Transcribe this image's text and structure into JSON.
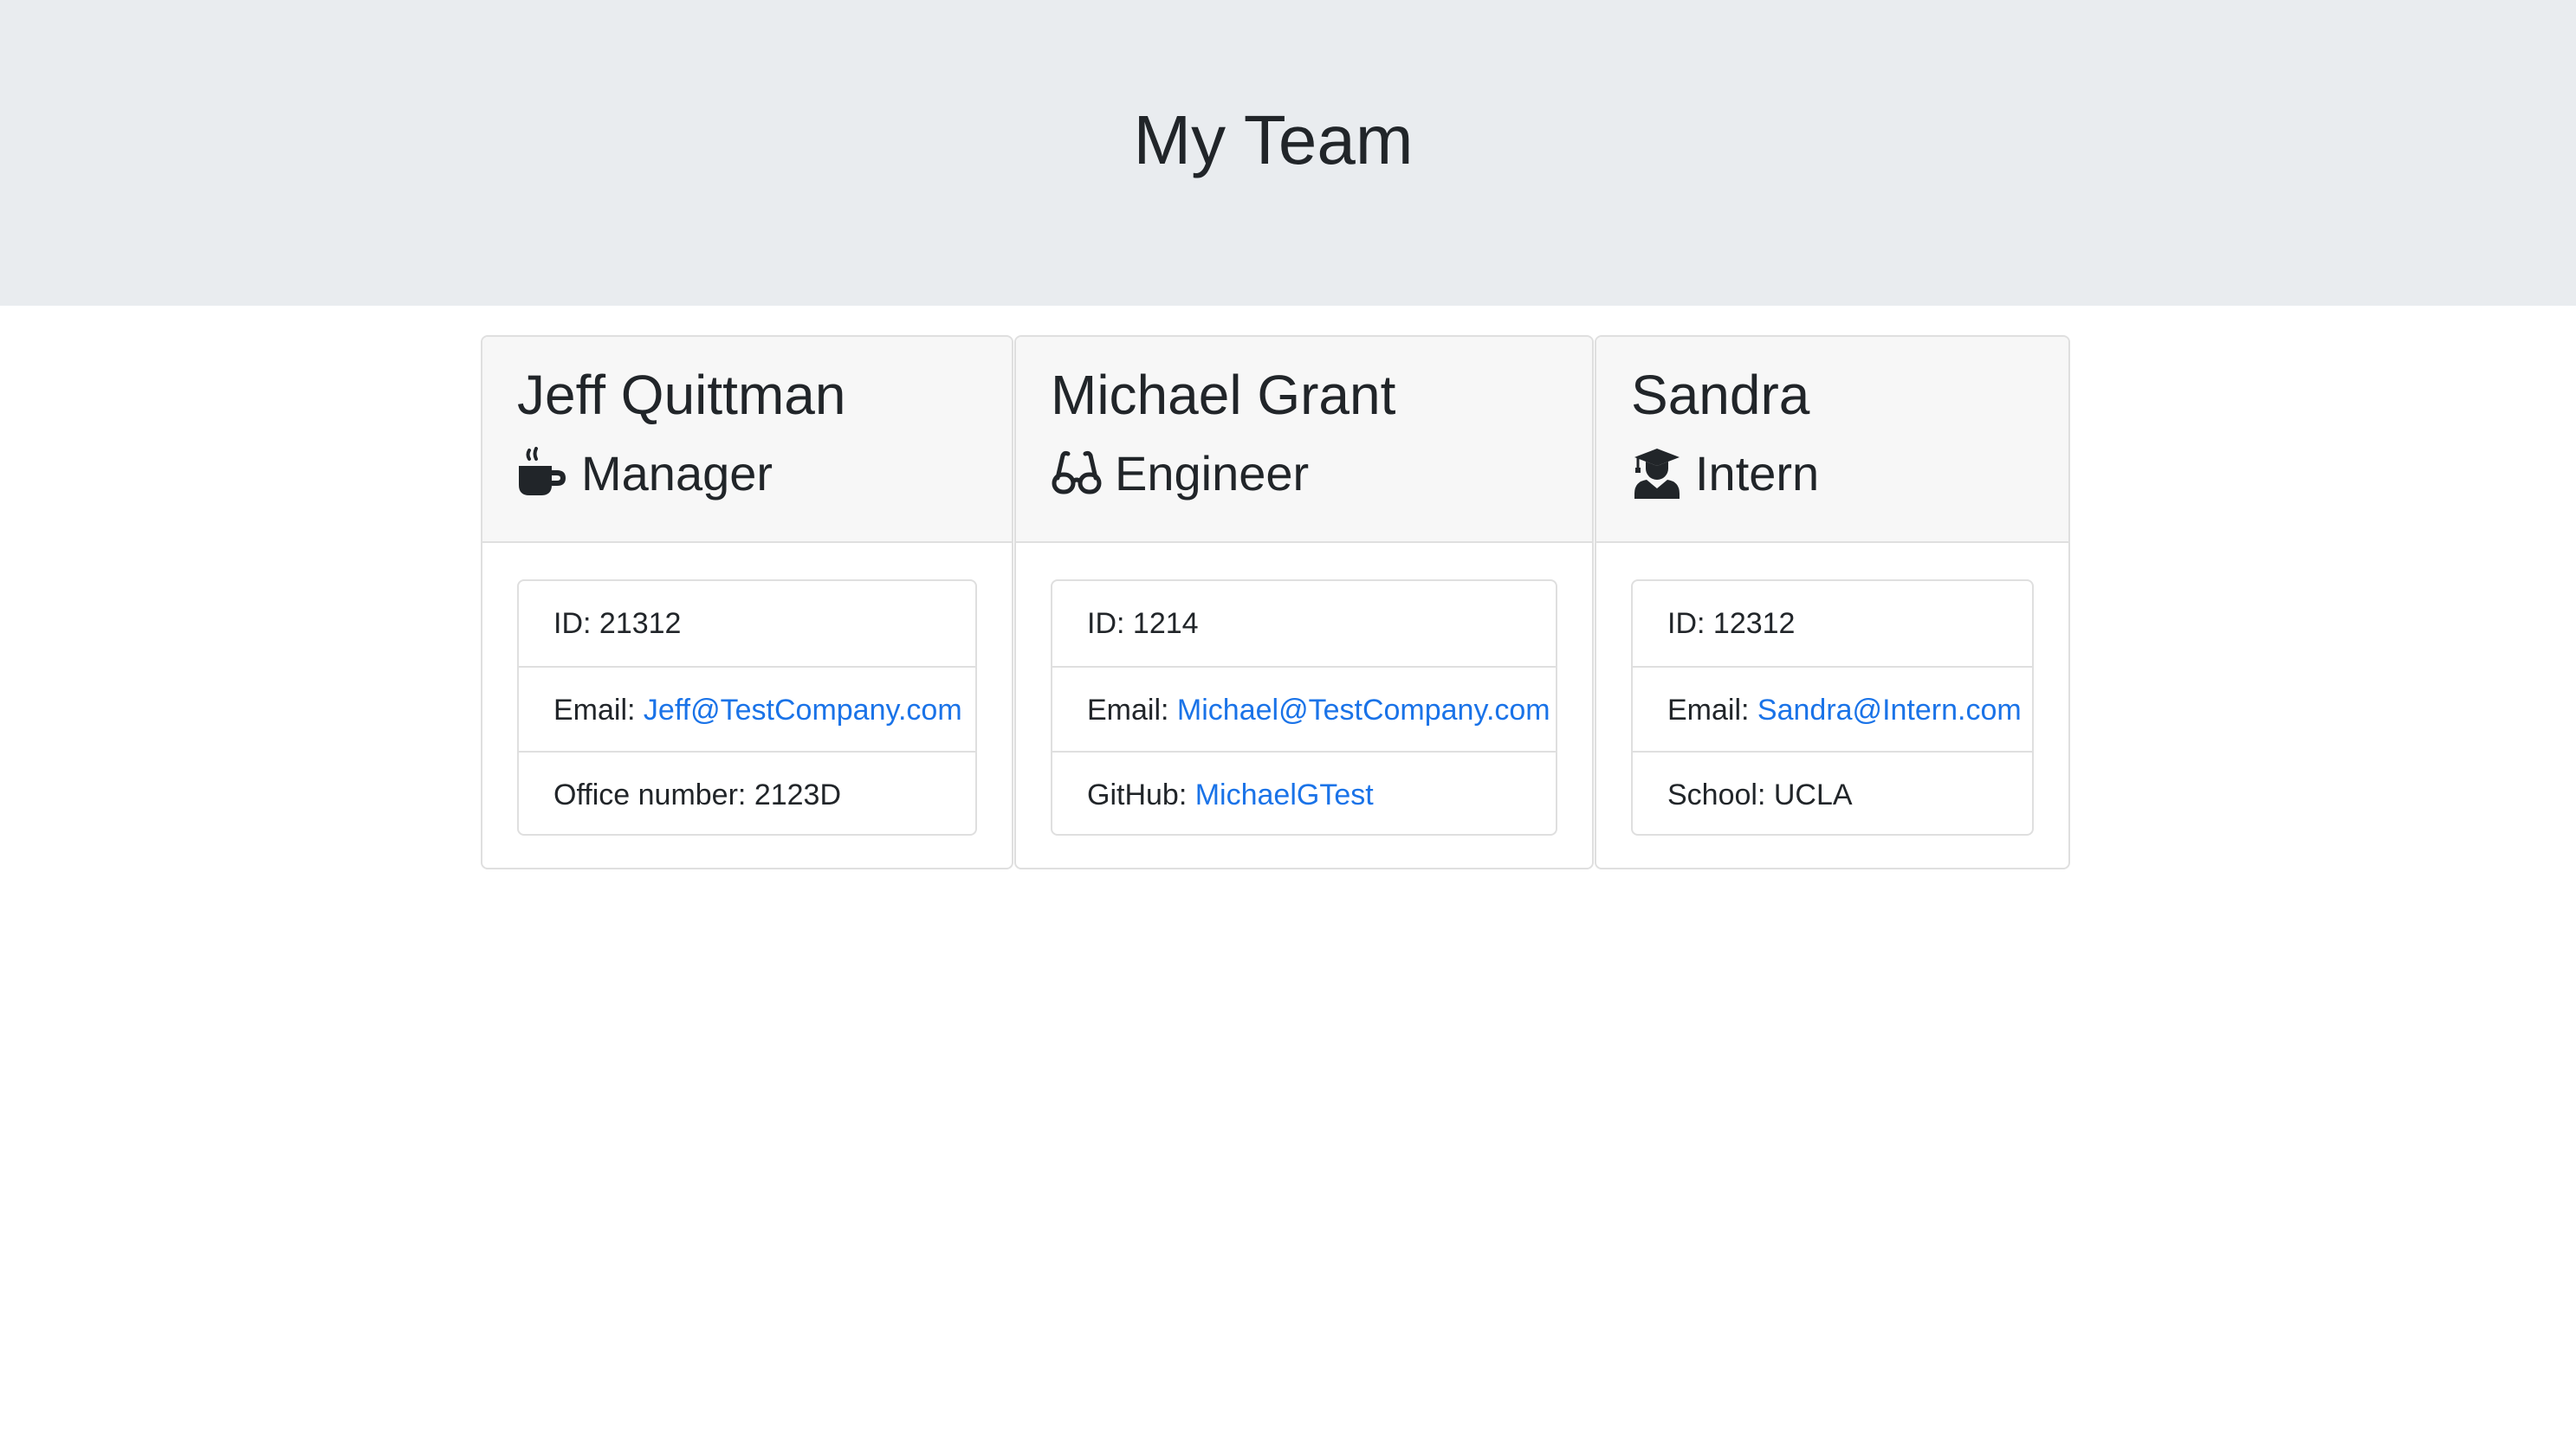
{
  "header": {
    "title": "My Team"
  },
  "employees": [
    {
      "name": "Jeff Quittman",
      "role": "Manager",
      "role_icon": "coffee-icon",
      "id_label": "ID: ",
      "id": "21312",
      "email_label": "Email: ",
      "email": "Jeff@TestCompany.com",
      "extra_label": "Office number: ",
      "extra_value": "2123D"
    },
    {
      "name": "Michael Grant",
      "role": "Engineer",
      "role_icon": "glasses-icon",
      "id_label": "ID: ",
      "id": "1214",
      "email_label": "Email: ",
      "email": "Michael@TestCompany.com",
      "extra_label": "GitHub: ",
      "extra_value": "MichaelGTest"
    },
    {
      "name": "Sandra",
      "role": "Intern",
      "role_icon": "user-graduate-icon",
      "id_label": "ID: ",
      "id": "12312",
      "email_label": "Email: ",
      "email": "Sandra@Intern.com",
      "extra_label": "School: ",
      "extra_value": "UCLA"
    }
  ],
  "colors": {
    "link": "#1a73e8",
    "jumbotron_bg": "#e9ecef",
    "card_header_bg": "#f7f7f7",
    "text": "#212529"
  }
}
